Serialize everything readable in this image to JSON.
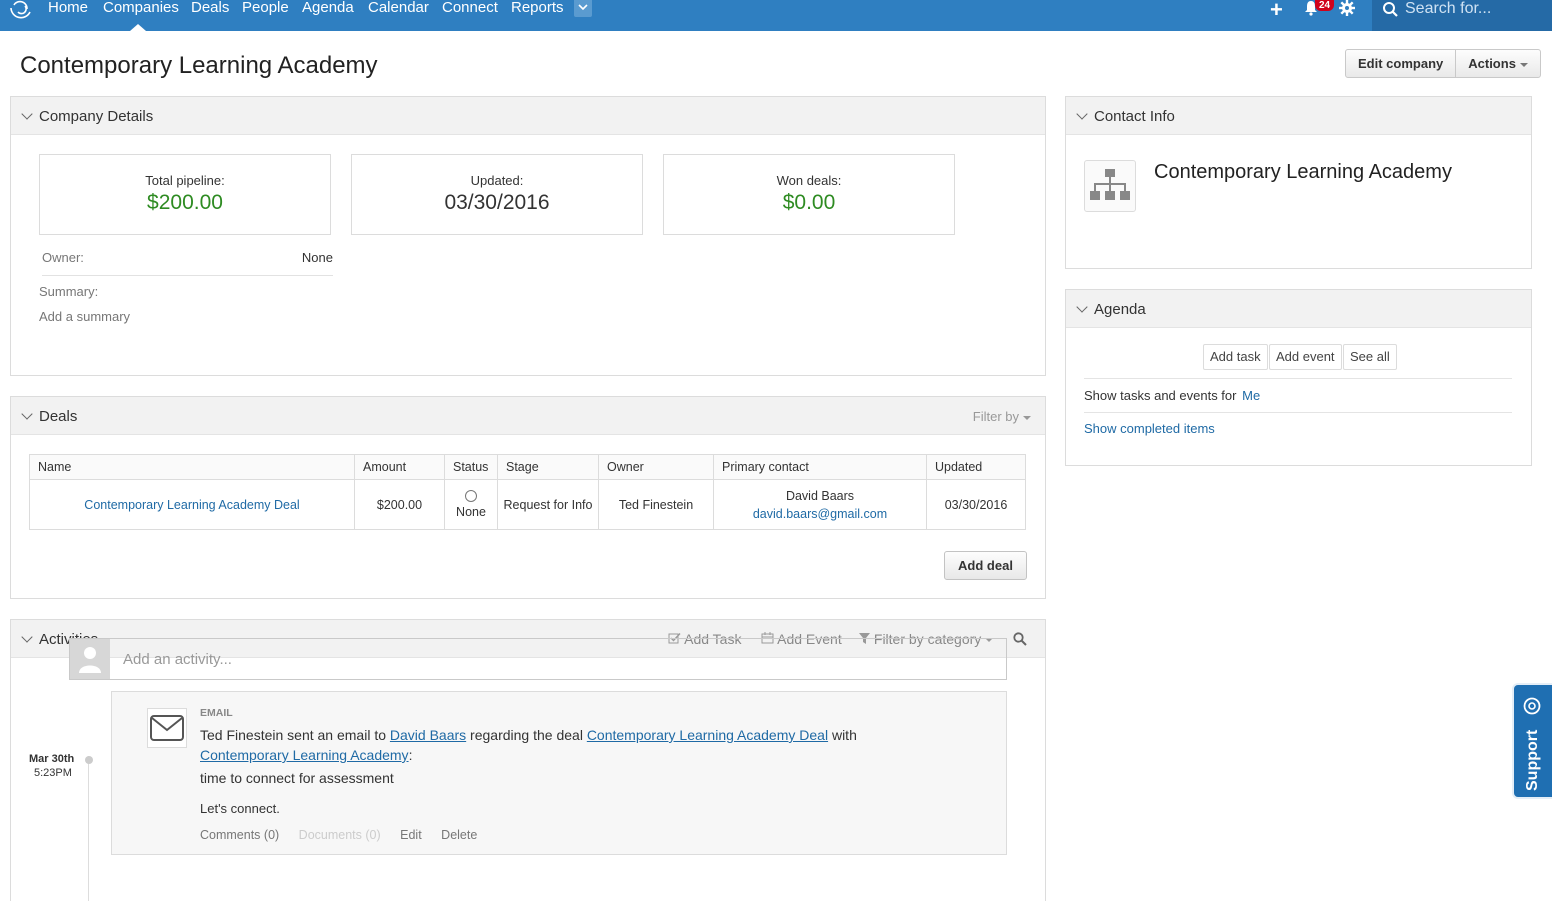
{
  "nav": {
    "items": [
      "Home",
      "Companies",
      "Deals",
      "People",
      "Agenda",
      "Calendar",
      "Connect",
      "Reports"
    ],
    "active": "Companies",
    "notification_count": "24",
    "search_placeholder": "Search for..."
  },
  "page": {
    "title": "Contemporary Learning Academy",
    "edit_button": "Edit company",
    "actions_button": "Actions"
  },
  "company_details": {
    "title": "Company Details",
    "total_pipeline_label": "Total pipeline:",
    "total_pipeline_value": "$200.00",
    "updated_label": "Updated:",
    "updated_value": "03/30/2016",
    "won_deals_label": "Won deals:",
    "won_deals_value": "$0.00",
    "owner_label": "Owner:",
    "owner_value": "None",
    "summary_label": "Summary:",
    "summary_placeholder": "Add a summary"
  },
  "deals": {
    "title": "Deals",
    "filter_label": "Filter by",
    "columns": [
      "Name",
      "Amount",
      "Status",
      "Stage",
      "Owner",
      "Primary contact",
      "Updated"
    ],
    "rows": [
      {
        "name": "Contemporary Learning Academy Deal",
        "amount": "$200.00",
        "status": "None",
        "stage": "Request for Info",
        "owner": "Ted Finestein",
        "contact_name": "David Baars",
        "contact_email": "david.baars@gmail.com",
        "updated": "03/30/2016"
      }
    ],
    "add_button": "Add deal"
  },
  "activities": {
    "title": "Activities",
    "add_task": "Add Task",
    "add_event": "Add Event",
    "filter": "Filter by category",
    "input_placeholder": "Add an activity...",
    "items": [
      {
        "date": "Mar 30th",
        "time": "5:23PM",
        "type": "EMAIL",
        "actor": "Ted Finestein",
        "text_1": " sent an email to ",
        "contact": "David Baars",
        "text_2": " regarding the deal ",
        "deal": "Contemporary Learning Academy Deal",
        "text_3": " with",
        "company": "Contemporary Learning Academy",
        "text_4": ":",
        "subject": "time to connect for assessment",
        "body": "Let's connect.",
        "comments": "Comments (0)",
        "documents": "Documents (0)",
        "edit": "Edit",
        "delete": "Delete"
      }
    ]
  },
  "contact_info": {
    "title": "Contact Info",
    "company_name": "Contemporary Learning Academy"
  },
  "agenda": {
    "title": "Agenda",
    "add_task": "Add task",
    "add_event": "Add event",
    "see_all": "See all",
    "show_for_label": "Show tasks and events for",
    "show_for_value": "Me",
    "show_completed": "Show completed items"
  },
  "support": {
    "label": "Support"
  },
  "colors": {
    "nav_bg": "#2f7fc1",
    "money_green": "#2e8b22",
    "link_blue": "#1f6aa5",
    "badge_red": "#d0021b"
  }
}
